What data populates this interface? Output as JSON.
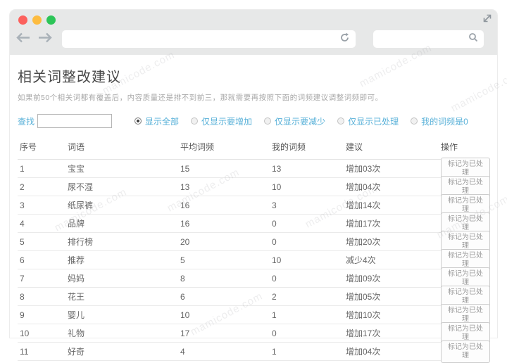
{
  "browser": {
    "traffic_lights": [
      "#fc615d",
      "#fdbc40",
      "#2dc558"
    ],
    "icons": {
      "back": "←",
      "forward": "→",
      "reload": "⟳",
      "search": "⌕",
      "expand": "⤢"
    },
    "url_value": "",
    "search_value": ""
  },
  "page": {
    "title": "相关词整改建议",
    "description": "如果前50个相关词都有覆盖后，内容质量还是排不到前三，那就需要再按照下面的词频建议调整词频即可。",
    "watermark": "mamicode.com"
  },
  "filter": {
    "search_label": "查找",
    "search_value": "",
    "options": [
      {
        "label": "显示全部",
        "selected": true
      },
      {
        "label": "仅显示要增加",
        "selected": false
      },
      {
        "label": "仅显示要减少",
        "selected": false
      },
      {
        "label": "仅显示已处理",
        "selected": false
      },
      {
        "label": "我的词频是0",
        "selected": false
      }
    ]
  },
  "table": {
    "headers": [
      "序号",
      "词语",
      "平均词频",
      "我的词频",
      "建议",
      "操作"
    ],
    "action_label": "标记为已处理",
    "rows": [
      {
        "index": "1",
        "word": "宝宝",
        "avg": "15",
        "mine": "13",
        "suggestion": "增加03次"
      },
      {
        "index": "2",
        "word": "尿不湿",
        "avg": "13",
        "mine": "10",
        "suggestion": "增加04次"
      },
      {
        "index": "3",
        "word": "纸尿裤",
        "avg": "16",
        "mine": "3",
        "suggestion": "增加14次"
      },
      {
        "index": "4",
        "word": "品牌",
        "avg": "16",
        "mine": "0",
        "suggestion": "增加17次"
      },
      {
        "index": "5",
        "word": "排行榜",
        "avg": "20",
        "mine": "0",
        "suggestion": "增加20次"
      },
      {
        "index": "6",
        "word": "推荐",
        "avg": "5",
        "mine": "10",
        "suggestion": "减少4次"
      },
      {
        "index": "7",
        "word": "妈妈",
        "avg": "8",
        "mine": "0",
        "suggestion": "增加09次"
      },
      {
        "index": "8",
        "word": "花王",
        "avg": "6",
        "mine": "2",
        "suggestion": "增加05次"
      },
      {
        "index": "9",
        "word": "婴儿",
        "avg": "10",
        "mine": "1",
        "suggestion": "增加10次"
      },
      {
        "index": "10",
        "word": "礼物",
        "avg": "17",
        "mine": "0",
        "suggestion": "增加17次"
      },
      {
        "index": "11",
        "word": "好奇",
        "avg": "4",
        "mine": "1",
        "suggestion": "增加04次"
      }
    ]
  },
  "colors": {
    "accent_blue": "#57b0d8",
    "chrome_gray": "#e7e8e8",
    "title_text": "#4a4a4a",
    "body_text": "#666666",
    "muted_text": "#a8a8a8",
    "border": "#e5e5e5"
  }
}
